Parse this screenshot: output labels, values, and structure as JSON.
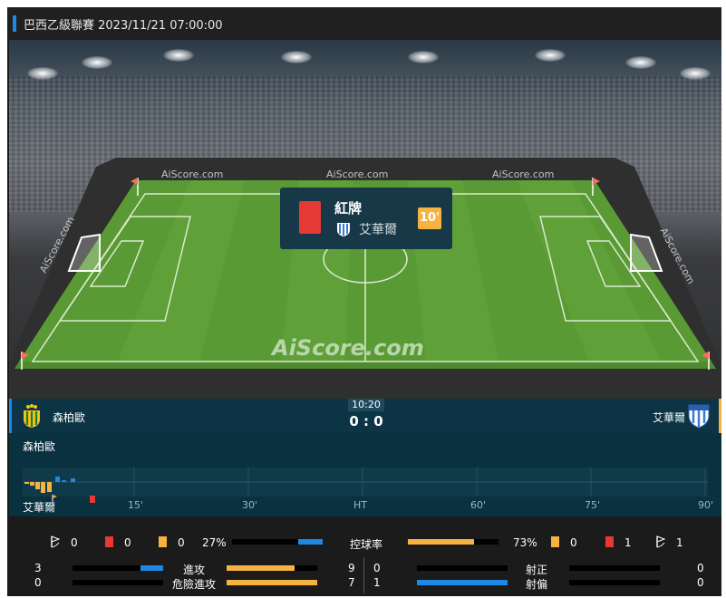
{
  "header": {
    "title": "巴西乙級聯賽 2023/11/21 07:00:00"
  },
  "pitch": {
    "watermark": "AiScore.com",
    "board_text": "AiScore.com"
  },
  "event": {
    "label": "紅牌",
    "team": "艾華爾",
    "minute": "10'"
  },
  "match": {
    "home": "森柏歐",
    "away": "艾華爾",
    "clock": "10:20",
    "score": "0 : 0"
  },
  "timeline": {
    "home_label": "森柏歐",
    "away_label": "艾華爾",
    "ticks": [
      "15'",
      "30'",
      "HT",
      "60'",
      "75'",
      "90'"
    ]
  },
  "stats": {
    "home_corners": "0",
    "home_red": "0",
    "home_yellow": "0",
    "home_possession": "27%",
    "possession_label": "控球率",
    "away_possession": "73%",
    "away_yellow": "0",
    "away_red": "1",
    "away_corners": "1",
    "home_possession_value": 27,
    "away_possession_value": 73,
    "attacks": {
      "label": "進攻",
      "home": "3",
      "away": "9",
      "home_value": 3,
      "away_value": 9
    },
    "dangerous": {
      "label": "危險進攻",
      "home": "0",
      "away": "7",
      "home_value": 0,
      "away_value": 7
    },
    "on_target": {
      "label": "射正",
      "home": "0",
      "away": "0"
    },
    "off_target": {
      "label": "射偏",
      "home": "1",
      "away": "0"
    }
  },
  "colors": {
    "home": "#1e88e5",
    "away": "#f5b342",
    "red_card": "#e53935",
    "pitch": "#5a9a34"
  },
  "icons": [
    "corner-flag-icon",
    "red-card-icon",
    "yellow-card-icon",
    "team-crest-icon"
  ]
}
